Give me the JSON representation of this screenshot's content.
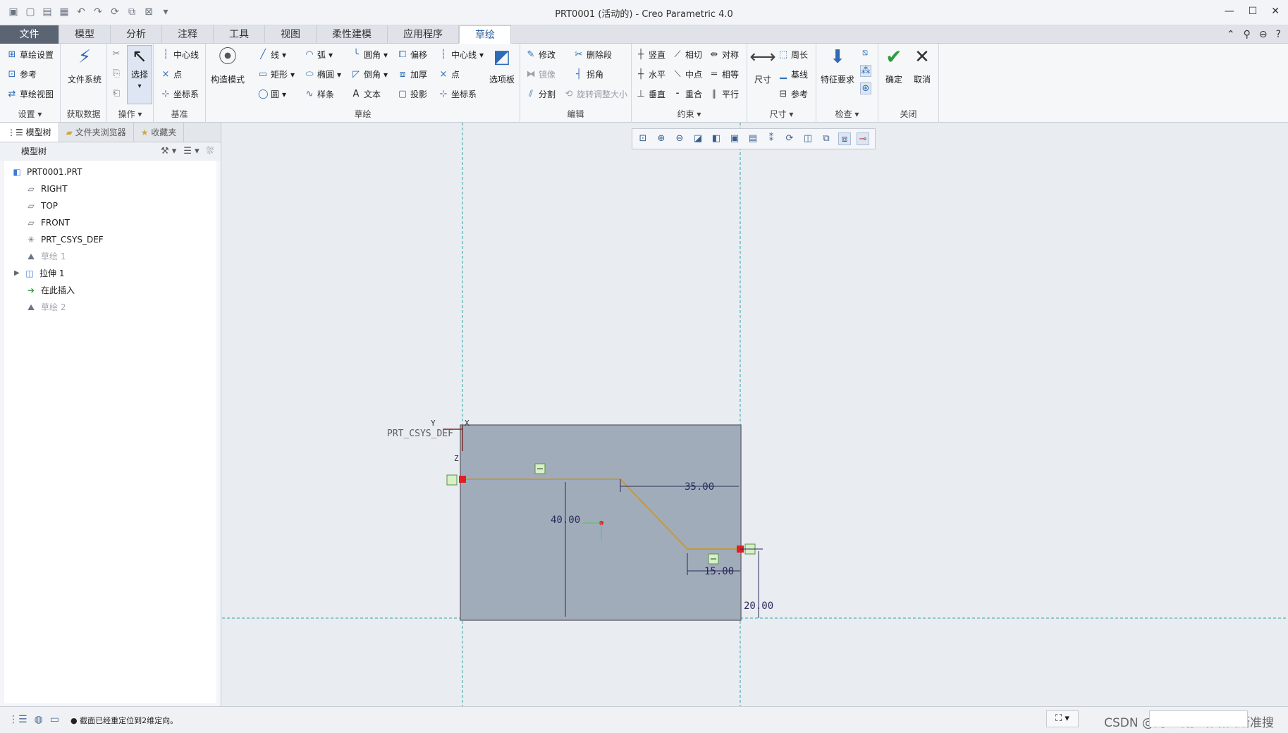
{
  "window": {
    "title": "PRT0001 (活动的) - Creo Parametric 4.0",
    "controls": [
      "—",
      "☐",
      "✕"
    ]
  },
  "tabs": [
    {
      "label": "文件"
    },
    {
      "label": "模型"
    },
    {
      "label": "分析"
    },
    {
      "label": "注释"
    },
    {
      "label": "工具"
    },
    {
      "label": "视图"
    },
    {
      "label": "柔性建模"
    },
    {
      "label": "应用程序"
    },
    {
      "label": "草绘"
    }
  ],
  "ribbon": {
    "settings": {
      "label": "设置",
      "items": [
        "草绘设置",
        "参考",
        "草绘视图"
      ]
    },
    "getdata": {
      "label": "获取数据",
      "file_system": "文件系统"
    },
    "operations": {
      "label": "操作",
      "select": "选择"
    },
    "datum": {
      "label": "基准",
      "items": [
        "中心线",
        "点",
        "坐标系"
      ]
    },
    "sketch": {
      "label": "草绘",
      "construction": "构造模式",
      "col1": [
        "线",
        "矩形",
        "圆"
      ],
      "col2": [
        "弧",
        "椭圆",
        "样条"
      ],
      "col3": [
        "圆角",
        "倒角",
        "文本"
      ],
      "col4": [
        "偏移",
        "加厚",
        "投影"
      ],
      "col5": [
        "中心线",
        "点",
        "坐标系"
      ],
      "palette": "选项板"
    },
    "edit": {
      "label": "编辑",
      "items": [
        "修改",
        "删除段",
        "镜像",
        "拐角",
        "分割",
        "旋转调整大小"
      ]
    },
    "constraints": {
      "label": "约束",
      "items": [
        "竖直",
        "相切",
        "对称",
        "水平",
        "中点",
        "相等",
        "垂直",
        "重合",
        "平行"
      ]
    },
    "dimension": {
      "label": "尺寸",
      "dim": "尺寸",
      "items": [
        "周长",
        "基线",
        "参考"
      ]
    },
    "inspect": {
      "label": "检查",
      "feature_req": "特征要求"
    },
    "close": {
      "label": "关闭",
      "ok": "确定",
      "cancel": "取消"
    }
  },
  "left_panel": {
    "tabs": [
      "模型树",
      "文件夹浏览器",
      "收藏夹"
    ],
    "tree_title": "模型树",
    "nodes": [
      {
        "label": "PRT0001.PRT",
        "icon": "part-icon"
      },
      {
        "label": "RIGHT",
        "icon": "datum-plane-icon"
      },
      {
        "label": "TOP",
        "icon": "datum-plane-icon"
      },
      {
        "label": "FRONT",
        "icon": "datum-plane-icon"
      },
      {
        "label": "PRT_CSYS_DEF",
        "icon": "csys-icon"
      },
      {
        "label": "草绘 1",
        "icon": "sketch-icon"
      },
      {
        "label": "拉伸 1",
        "icon": "extrude-icon"
      },
      {
        "label": "在此插入",
        "icon": "insert-arrow-icon"
      },
      {
        "label": "草绘 2",
        "icon": "sketch-icon"
      }
    ]
  },
  "canvas": {
    "csys_label": "PRT_CSYS_DEF",
    "axis_y": "Y",
    "axis_x": "X",
    "axis_z": "Z",
    "dims": [
      "35.00",
      "40.00",
      "15.00",
      "20.00"
    ]
  },
  "status": {
    "message": "● 截面已经重定位到2维定向。",
    "watermark": "CSDN @阿里嘎多哈哈西斯准搜"
  }
}
